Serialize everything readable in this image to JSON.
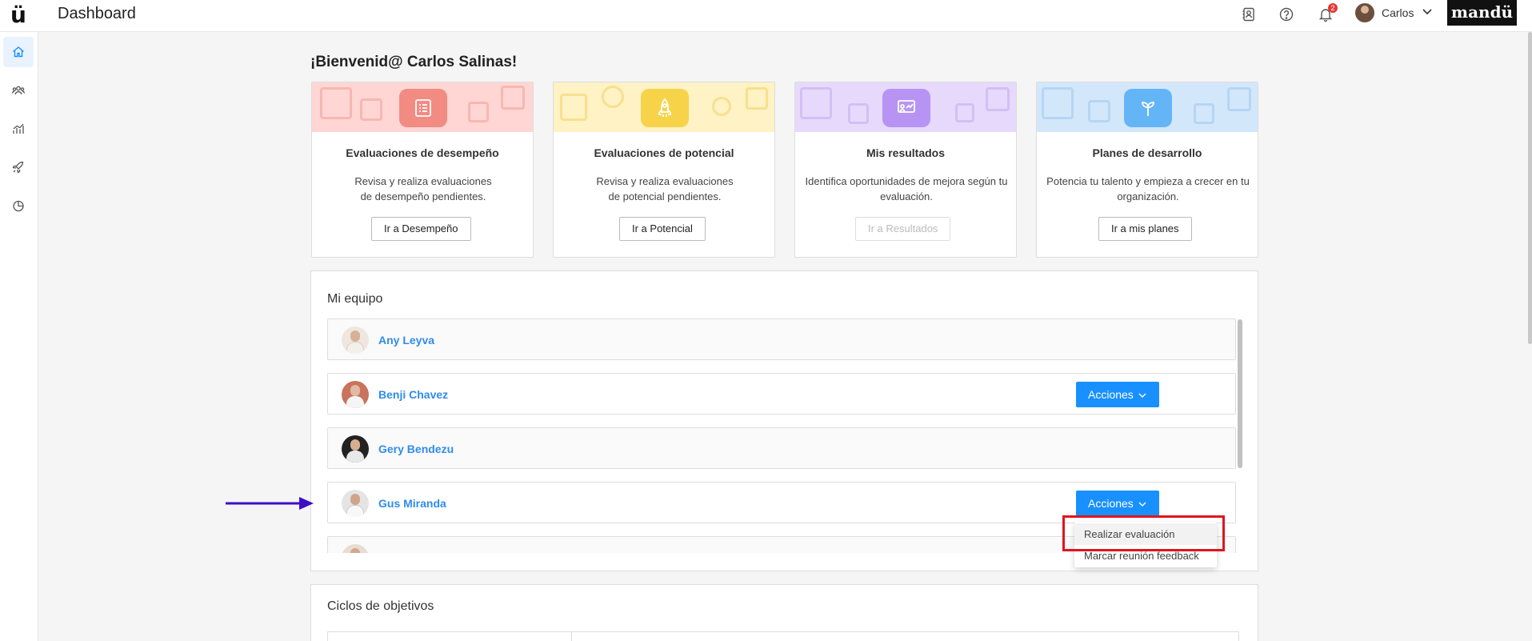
{
  "header": {
    "logo": "ü",
    "title": "Dashboard",
    "notifications_count": "2",
    "user_name": "Carlos",
    "brand": "mandü"
  },
  "sidebar": {
    "items": [
      {
        "icon": "home-icon",
        "active": true
      },
      {
        "icon": "team-icon"
      },
      {
        "icon": "analytics-icon"
      },
      {
        "icon": "rocket-icon"
      },
      {
        "icon": "pie-chart-icon"
      }
    ]
  },
  "welcome": "¡Bienvenid@ Carlos Salinas!",
  "cards": [
    {
      "title": "Evaluaciones de desempeño",
      "desc_line1": "Revisa y realiza evaluaciones",
      "desc_line2": "de desempeño pendientes.",
      "button": "Ir a Desempeño",
      "icon": "checklist-icon",
      "color": "#f28b82",
      "banner": "#ffd6d3"
    },
    {
      "title": "Evaluaciones de potencial",
      "desc_line1": "Revisa y realiza evaluaciones",
      "desc_line2": "de potencial pendientes.",
      "button": "Ir a Potencial",
      "icon": "rocket-icon",
      "color": "#f7d34a",
      "banner": "#fff2c4"
    },
    {
      "title": "Mis resultados",
      "desc_line1": "Identifica oportunidades de mejora según tu",
      "desc_line2": "evaluación.",
      "button": "Ir a Resultados",
      "icon": "presentation-icon",
      "color": "#b794f4",
      "banner": "#e6d9fb"
    },
    {
      "title": "Planes de desarrollo",
      "desc_line1": "Potencia tu talento y empieza a crecer en tu",
      "desc_line2": "organización.",
      "button": "Ir a mis planes",
      "icon": "sprout-icon",
      "color": "#64b5f6",
      "banner": "#d3e7fb"
    }
  ],
  "team": {
    "title": "Mi equipo",
    "members": [
      {
        "name": "Any Leyva",
        "has_actions": false
      },
      {
        "name": "Benji Chavez",
        "has_actions": true
      },
      {
        "name": "Gery Bendezu",
        "has_actions": false
      },
      {
        "name": "Gus Miranda",
        "has_actions": true
      }
    ],
    "actions_label": "Acciones"
  },
  "dropdown": {
    "items": [
      "Realizar evaluación",
      "Marcar reunión feedback"
    ]
  },
  "objectives": {
    "title": "Ciclos de objetivos"
  },
  "colors": {
    "primary": "#1890ff",
    "link": "#2f8ceb",
    "highlight": "#e0141e",
    "arrow": "#3d10c7"
  }
}
